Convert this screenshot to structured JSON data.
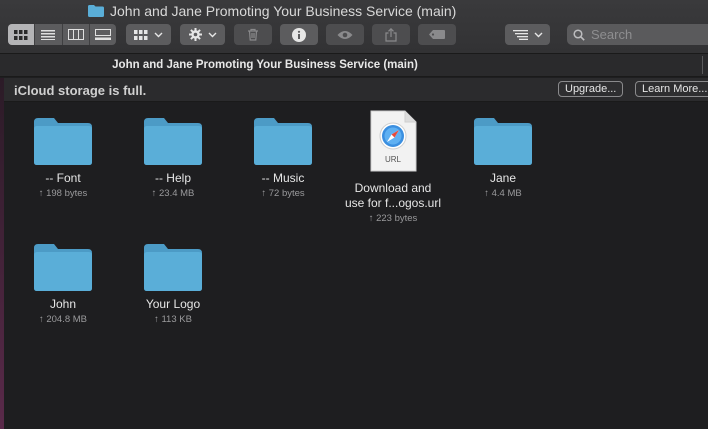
{
  "window": {
    "title": "John and Jane Promoting Your Business Service (main)"
  },
  "toolbar": {
    "view_modes": [
      "icon-view",
      "list-view",
      "column-view",
      "gallery-view"
    ],
    "active_view": "icon-view",
    "search_placeholder": "Search"
  },
  "pathbar": {
    "path": "John and Jane Promoting Your Business Service (main)"
  },
  "banner": {
    "message": "iCloud storage is full.",
    "upgrade_label": "Upgrade...",
    "learn_more_label": "Learn More..."
  },
  "items": [
    {
      "name_line1": "-- Font",
      "name_line2": "",
      "size": "↑ 198 bytes",
      "kind": "folder"
    },
    {
      "name_line1": "-- Help",
      "name_line2": "",
      "size": "↑ 23.4 MB",
      "kind": "folder"
    },
    {
      "name_line1": "-- Music",
      "name_line2": "",
      "size": "↑ 72 bytes",
      "kind": "folder"
    },
    {
      "name_line1": "Download and",
      "name_line2": "use for f...ogos.url",
      "size": "↑ 223 bytes",
      "kind": "url-file",
      "badge": "URL"
    },
    {
      "name_line1": "Jane",
      "name_line2": "",
      "size": "↑ 4.4 MB",
      "kind": "folder"
    },
    {
      "name_line1": "John",
      "name_line2": "",
      "size": "↑ 204.8 MB",
      "kind": "folder"
    },
    {
      "name_line1": "Your Logo",
      "name_line2": "",
      "size": "↑ 113 KB",
      "kind": "folder"
    }
  ],
  "colors": {
    "folder": "#5aaed8",
    "folder_tab": "#4c9bc6",
    "background": "#1e1e20"
  }
}
